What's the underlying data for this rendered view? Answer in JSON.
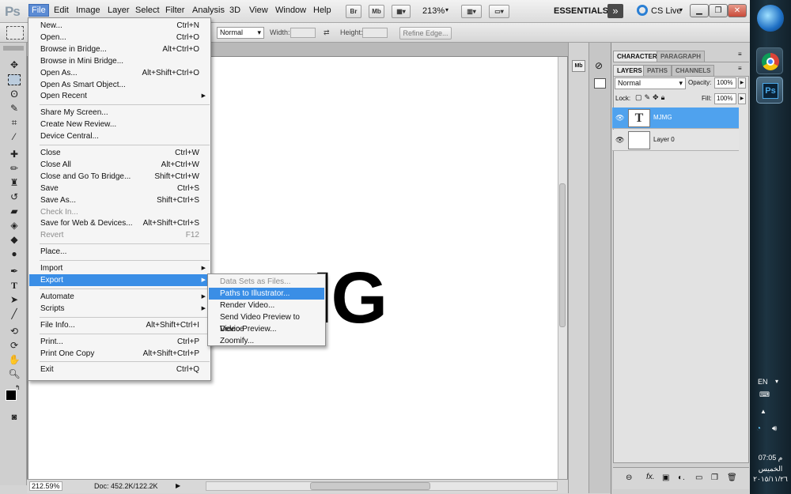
{
  "app": {
    "logo": "Ps"
  },
  "menubar": {
    "items": [
      "File",
      "Edit",
      "Image",
      "Layer",
      "Select",
      "Filter",
      "Analysis",
      "3D",
      "View",
      "Window",
      "Help"
    ],
    "bridge": "Br",
    "minibridge": "Mb",
    "zoom": "213%",
    "workspace": "ESSENTIALS",
    "cs_live": "CS Live",
    "expand": "»"
  },
  "options": {
    "mode": "Normal",
    "width_label": "Width:",
    "height_label": "Height:",
    "refine_edge": "Refine Edge..."
  },
  "canvas": {
    "text": "MJMG",
    "visible_text": "IG"
  },
  "status": {
    "zoom": "212.59%",
    "doc": "Doc: 452.2K/122.2K"
  },
  "panels": {
    "tabs_top": [
      "CHARACTER",
      "PARAGRAPH"
    ],
    "tabs_layers": [
      "LAYERS",
      "PATHS",
      "CHANNELS"
    ],
    "blend_mode": "Normal",
    "opacity_label": "Opacity:",
    "opacity": "100%",
    "lock_label": "Lock:",
    "fill_label": "Fill:",
    "fill": "100%",
    "layers": [
      {
        "name": "MJMG",
        "thumb": "T",
        "selected": true
      },
      {
        "name": "Layer 0",
        "thumb": "",
        "selected": false
      }
    ]
  },
  "file_menu": {
    "groups": [
      [
        {
          "label": "New...",
          "sc": "Ctrl+N"
        },
        {
          "label": "Open...",
          "sc": "Ctrl+O"
        },
        {
          "label": "Browse in Bridge...",
          "sc": "Alt+Ctrl+O"
        },
        {
          "label": "Browse in Mini Bridge...",
          "sc": ""
        },
        {
          "label": "Open As...",
          "sc": "Alt+Shift+Ctrl+O"
        },
        {
          "label": "Open As Smart Object...",
          "sc": ""
        },
        {
          "label": "Open Recent",
          "sc": "",
          "sub": true
        }
      ],
      [
        {
          "label": "Share My Screen...",
          "sc": ""
        },
        {
          "label": "Create New Review...",
          "sc": ""
        },
        {
          "label": "Device Central...",
          "sc": ""
        }
      ],
      [
        {
          "label": "Close",
          "sc": "Ctrl+W"
        },
        {
          "label": "Close All",
          "sc": "Alt+Ctrl+W"
        },
        {
          "label": "Close and Go To Bridge...",
          "sc": "Shift+Ctrl+W"
        },
        {
          "label": "Save",
          "sc": "Ctrl+S"
        },
        {
          "label": "Save As...",
          "sc": "Shift+Ctrl+S"
        },
        {
          "label": "Check In...",
          "sc": "",
          "dis": true
        },
        {
          "label": "Save for Web & Devices...",
          "sc": "Alt+Shift+Ctrl+S"
        },
        {
          "label": "Revert",
          "sc": "F12",
          "dis": true
        }
      ],
      [
        {
          "label": "Place...",
          "sc": ""
        }
      ],
      [
        {
          "label": "Import",
          "sc": "",
          "sub": true
        },
        {
          "label": "Export",
          "sc": "",
          "sub": true,
          "hl": true
        }
      ],
      [
        {
          "label": "Automate",
          "sc": "",
          "sub": true
        },
        {
          "label": "Scripts",
          "sc": "",
          "sub": true
        }
      ],
      [
        {
          "label": "File Info...",
          "sc": "Alt+Shift+Ctrl+I"
        }
      ],
      [
        {
          "label": "Print...",
          "sc": "Ctrl+P"
        },
        {
          "label": "Print One Copy",
          "sc": "Alt+Shift+Ctrl+P"
        }
      ],
      [
        {
          "label": "Exit",
          "sc": "Ctrl+Q"
        }
      ]
    ]
  },
  "export_menu": [
    {
      "label": "Data Sets as Files...",
      "dis": true
    },
    {
      "label": "Paths to Illustrator...",
      "hl": true
    },
    {
      "label": "Render Video..."
    },
    {
      "label": "Send Video Preview to Device"
    },
    {
      "label": "Video Preview..."
    },
    {
      "label": "Zoomify..."
    }
  ],
  "taskbar": {
    "lang": "EN",
    "time": "07:05 م",
    "day": "الخميس",
    "date": "٢٠١٥/١١/٢٦"
  },
  "colors": {
    "highlight": "#3a8ee6",
    "layer_selected": "#4fa2ee",
    "taskbar": "#1d3442"
  }
}
